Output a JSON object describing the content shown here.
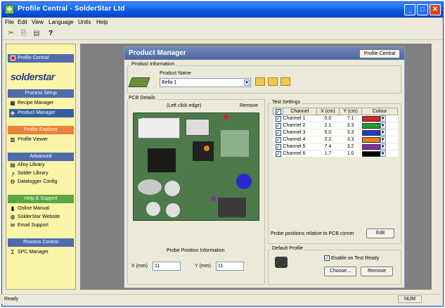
{
  "window": {
    "title": "Profile Central - SolderStar Ltd"
  },
  "title_buttons": {
    "minimize": "_",
    "maximize": "□",
    "close": "✕"
  },
  "menu": [
    "File",
    "Edit",
    "View",
    "Language",
    "Units",
    "Help"
  ],
  "sidebar": {
    "logo": "solderstar",
    "top_item": "Profile Central",
    "sections": [
      {
        "header": "Process Setup",
        "color": "#4f6bad",
        "items": [
          "Recipe Manager",
          "Product Manager"
        ]
      },
      {
        "header": "Profile Explorer",
        "color": "#e8823a",
        "items": [
          "Profile Viewer"
        ]
      },
      {
        "header": "Advanced",
        "color": "#4f6bad",
        "items": [
          "Alloy Library",
          "Solder Library",
          "Datalogger Config"
        ]
      },
      {
        "header": "Help & Support",
        "color": "#5aa63f",
        "items": [
          "Online Manual",
          "SolderStar Website",
          "Email Support"
        ]
      },
      {
        "header": "Process Control",
        "color": "#4f6bad",
        "items": [
          "SPC Manager"
        ]
      }
    ]
  },
  "product_manager": {
    "title": "Product Manager",
    "close_button": "Profile Central",
    "product_info_label": "Product Information",
    "product_name_label": "Product Name",
    "product_name_value": "Bella 1",
    "pcb_details_label": "PCB Details",
    "image_caption": "(Left click edge)",
    "remove_label": "Remove",
    "probe_info_label": "Probe Position Information",
    "x_label": "X (mm)",
    "x_value": "11",
    "y_label": "Y (mm)",
    "y_value": "11",
    "test_settings_label": "Test Settings",
    "columns": [
      "Channel",
      "X (cm)",
      "Y (cm)",
      "Colour"
    ],
    "channels": [
      {
        "name": "Channel 1",
        "x": "0.0",
        "y": "7.1",
        "color": "#e02020"
      },
      {
        "name": "Channel 2",
        "x": "2.1",
        "y": "3.3",
        "color": "#20a030"
      },
      {
        "name": "Channel 3",
        "x": "5.0",
        "y": "3.3",
        "color": "#2038d0"
      },
      {
        "name": "Channel 4",
        "x": "2.1",
        "y": "3.3",
        "color": "#e8801a"
      },
      {
        "name": "Channel 5",
        "x": "7.4",
        "y": "3.2",
        "color": "#8a2aa8"
      },
      {
        "name": "Channel 6",
        "x": "1.7",
        "y": "1.0",
        "color": "#000000"
      }
    ],
    "edit_caption": "Probe positions relative to PCB corner",
    "edit_button": "Edit",
    "default_profile_label": "Default Profile",
    "enable_checkbox_label": "Enable on Test Ready",
    "choose_button": "Choose...",
    "remove_button": "Remove"
  },
  "status": {
    "left": "Ready",
    "right": "NUM"
  }
}
